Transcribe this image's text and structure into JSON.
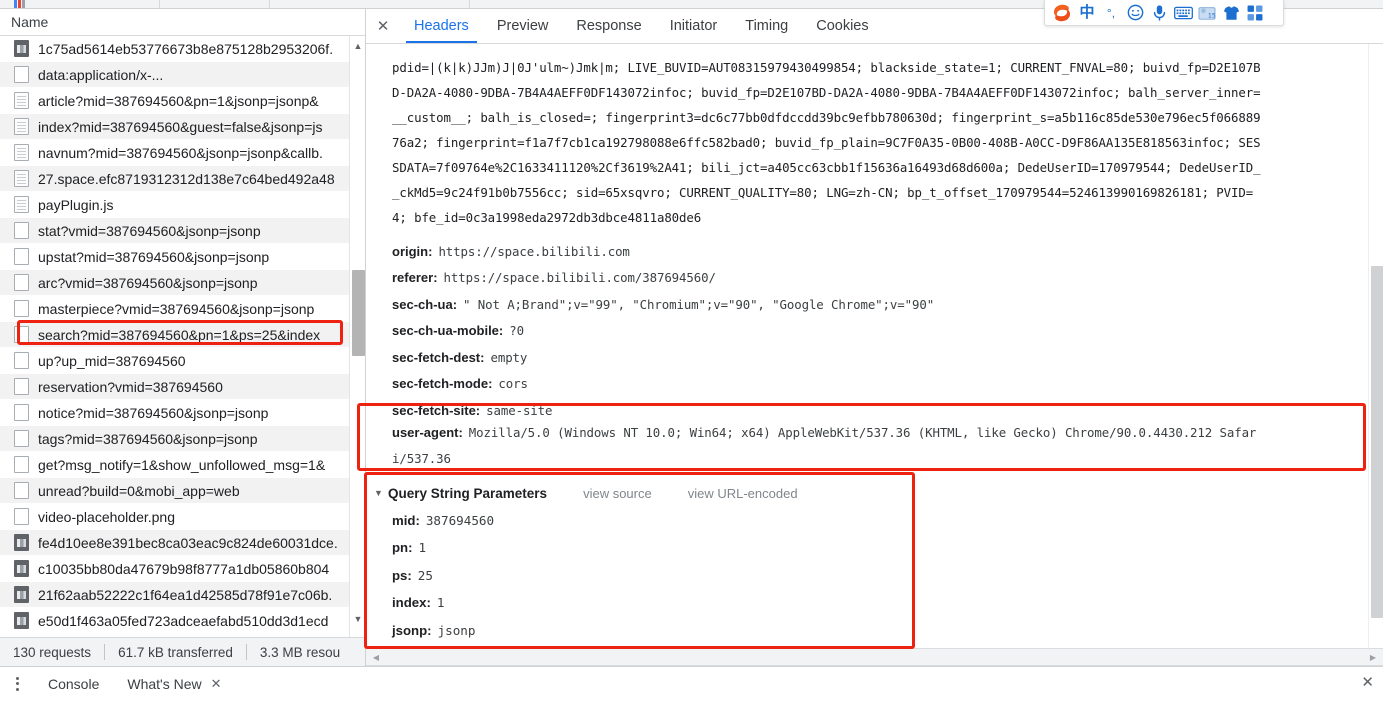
{
  "sidebar": {
    "header": "Name",
    "rows": [
      {
        "label": "1c75ad5614eb53776673b8e875128b2953206f.",
        "icon": "image-file-icon",
        "shade": "plain"
      },
      {
        "label": "data:application/x-...",
        "icon": "blank-file-icon",
        "shade": "alt"
      },
      {
        "label": "article?mid=387694560&pn=1&jsonp=jsonp&",
        "icon": "document-file-icon",
        "shade": "plain"
      },
      {
        "label": "index?mid=387694560&guest=false&jsonp=js",
        "icon": "document-file-icon",
        "shade": "alt"
      },
      {
        "label": "navnum?mid=387694560&jsonp=jsonp&callb.",
        "icon": "document-file-icon",
        "shade": "plain"
      },
      {
        "label": "27.space.efc8719312312d138e7c64bed492a48",
        "icon": "document-file-icon",
        "shade": "alt"
      },
      {
        "label": "payPlugin.js",
        "icon": "document-file-icon",
        "shade": "plain"
      },
      {
        "label": "stat?vmid=387694560&jsonp=jsonp",
        "icon": "blank-file-icon",
        "shade": "alt"
      },
      {
        "label": "upstat?mid=387694560&jsonp=jsonp",
        "icon": "blank-file-icon",
        "shade": "plain"
      },
      {
        "label": "arc?vmid=387694560&jsonp=jsonp",
        "icon": "blank-file-icon",
        "shade": "alt"
      },
      {
        "label": "masterpiece?vmid=387694560&jsonp=jsonp",
        "icon": "blank-file-icon",
        "shade": "plain"
      },
      {
        "label": "search?mid=387694560&pn=1&ps=25&index",
        "icon": "blank-file-icon",
        "shade": "alt",
        "highlighted": true
      },
      {
        "label": "up?up_mid=387694560",
        "icon": "blank-file-icon",
        "shade": "plain"
      },
      {
        "label": "reservation?vmid=387694560",
        "icon": "blank-file-icon",
        "shade": "alt"
      },
      {
        "label": "notice?mid=387694560&jsonp=jsonp",
        "icon": "blank-file-icon",
        "shade": "plain"
      },
      {
        "label": "tags?mid=387694560&jsonp=jsonp",
        "icon": "blank-file-icon",
        "shade": "alt"
      },
      {
        "label": "get?msg_notify=1&show_unfollowed_msg=1&",
        "icon": "blank-file-icon",
        "shade": "plain"
      },
      {
        "label": "unread?build=0&mobi_app=web",
        "icon": "blank-file-icon",
        "shade": "alt"
      },
      {
        "label": "video-placeholder.png",
        "icon": "blank-file-icon",
        "shade": "plain"
      },
      {
        "label": "fe4d10ee8e391bec8ca03eac9c824de60031dce.",
        "icon": "image-file-icon",
        "shade": "alt"
      },
      {
        "label": "c10035bb80da47679b98f8777a1db05860b804",
        "icon": "image-file-icon",
        "shade": "plain"
      },
      {
        "label": "21f62aab52222c1f64ea1d42585d78f91e7c06b.",
        "icon": "image-file-icon",
        "shade": "alt"
      },
      {
        "label": "e50d1f463a05fed723adceaefabd510dd3d1ecd",
        "icon": "image-file-icon",
        "shade": "plain"
      }
    ],
    "scroll_up_icon": "scroll-up-arrow-icon",
    "scroll_down_icon": "scroll-down-arrow-icon"
  },
  "summary": {
    "requests": "130 requests",
    "transferred": "61.7 kB transferred",
    "resources": "3.3 MB resou"
  },
  "detail": {
    "close_icon": "close-icon",
    "tabs": [
      {
        "label": "Headers",
        "active": true
      },
      {
        "label": "Preview",
        "active": false
      },
      {
        "label": "Response",
        "active": false
      },
      {
        "label": "Initiator",
        "active": false
      },
      {
        "label": "Timing",
        "active": false
      },
      {
        "label": "Cookies",
        "active": false
      }
    ],
    "cookie_lines": [
      "pdid=|(k|k)JJm)J|0J'ulm~)Jmk|m; LIVE_BUVID=AUT08315979430499854; blackside_state=1; CURRENT_FNVAL=80; buivd_fp=D2E107B",
      "D-DA2A-4080-9DBA-7B4A4AEFF0DF143072infoc; buvid_fp=D2E107BD-DA2A-4080-9DBA-7B4A4AEFF0DF143072infoc; balh_server_inner=",
      "__custom__; balh_is_closed=; fingerprint3=dc6c77bb0dfdccdd39bc9efbb780630d; fingerprint_s=a5b116c85de530e796ec5f066889",
      "76a2; fingerprint=f1a7f7cb1ca192798088e6ffc582bad0; buvid_fp_plain=9C7F0A35-0B00-408B-A0CC-D9F86AA135E818563infoc; SES",
      "SDATA=7f09764e%2C1633411120%2Cf3619%2A41; bili_jct=a405cc63cbb1f15636a16493d68d600a; DedeUserID=170979544; DedeUserID_",
      "_ckMd5=9c24f91b0b7556cc; sid=65xsqvro; CURRENT_QUALITY=80; LNG=zh-CN; bp_t_offset_170979544=524613990169826181; PVID=",
      "4; bfe_id=0c3a1998eda2972db3dbce4811a80de6"
    ],
    "headers": [
      {
        "key": "origin:",
        "value": "https://space.bilibili.com"
      },
      {
        "key": "referer:",
        "value": "https://space.bilibili.com/387694560/"
      },
      {
        "key": "sec-ch-ua:",
        "value": "\" Not A;Brand\";v=\"99\", \"Chromium\";v=\"90\", \"Google Chrome\";v=\"90\""
      },
      {
        "key": "sec-ch-ua-mobile:",
        "value": "?0"
      },
      {
        "key": "sec-fetch-dest:",
        "value": "empty"
      },
      {
        "key": "sec-fetch-mode:",
        "value": "cors"
      },
      {
        "key": "sec-fetch-site:",
        "value": "same-site"
      }
    ],
    "user_agent": {
      "key": "user-agent:",
      "line1": "Mozilla/5.0 (Windows NT 10.0; Win64; x64) AppleWebKit/537.36 (KHTML, like Gecko) Chrome/90.0.4430.212 Safar",
      "line2": "i/537.36"
    },
    "query_string": {
      "triangle_icon": "triangle-down-icon",
      "title": "Query String Parameters",
      "view_source": "view source",
      "view_url_encoded": "view URL-encoded",
      "params": [
        {
          "key": "mid:",
          "value": "387694560"
        },
        {
          "key": "pn:",
          "value": "1"
        },
        {
          "key": "ps:",
          "value": "25"
        },
        {
          "key": "index:",
          "value": "1"
        },
        {
          "key": "jsonp:",
          "value": "jsonp"
        }
      ]
    },
    "hscroll_left_icon": "scroll-left-arrow-icon",
    "hscroll_right_icon": "scroll-right-arrow-icon"
  },
  "drawer": {
    "menu_icon": "kebab-menu-icon",
    "tabs": [
      {
        "label": "Console",
        "closable": false
      },
      {
        "label": "What's New",
        "closable": true,
        "close_icon": "close-icon"
      }
    ],
    "close_icon": "close-icon"
  },
  "ime": {
    "logo": "S",
    "items": [
      {
        "name": "sogou-logo-icon",
        "glyph": "S"
      },
      {
        "name": "chinese-mode-icon",
        "glyph": "中"
      },
      {
        "name": "punctuation-mode-icon",
        "glyph": "°,"
      },
      {
        "name": "emoji-icon",
        "glyph": "☺"
      },
      {
        "name": "microphone-icon",
        "glyph": "🎤"
      },
      {
        "name": "keyboard-icon",
        "glyph": "⌨"
      },
      {
        "name": "calendar-icon",
        "glyph": "15"
      },
      {
        "name": "skin-icon",
        "glyph": "👕"
      },
      {
        "name": "toolbox-icon",
        "glyph": "▦"
      }
    ]
  },
  "colors": {
    "accent": "#1a73e8",
    "annotation_red": "#ee2211",
    "ime_blue": "#1c6fd0",
    "logo_orange": "#ff5500"
  }
}
